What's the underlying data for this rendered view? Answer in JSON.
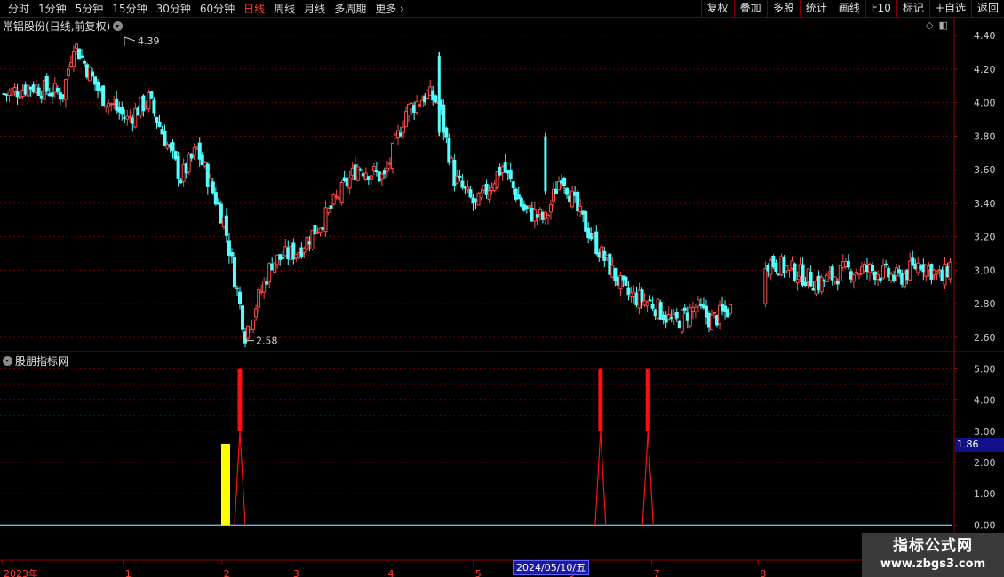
{
  "toolbar": {
    "periods": [
      "分时",
      "1分钟",
      "5分钟",
      "15分钟",
      "30分钟",
      "60分钟",
      "日线",
      "周线",
      "月线",
      "多周期",
      "更多"
    ],
    "active_period": "日线",
    "tools": [
      "复权",
      "叠加",
      "多股",
      "统计",
      "画线",
      "F10",
      "标记",
      "+自选",
      "返回"
    ]
  },
  "main_panel": {
    "title": "常铝股份(日线,前复权)"
  },
  "indicator_panel": {
    "title": "股朋指标网"
  },
  "price_axis": {
    "ticks": [
      "4.40",
      "4.20",
      "4.00",
      "3.80",
      "3.60",
      "3.40",
      "3.20",
      "3.00",
      "2.80",
      "2.60"
    ],
    "range": [
      2.52,
      4.48
    ]
  },
  "indicator_axis": {
    "ticks": [
      "5.00",
      "4.00",
      "3.00",
      "2.00",
      "1.00",
      "0.00"
    ],
    "range": [
      -1.1,
      5.5
    ],
    "current_value": "1.86"
  },
  "annotations": {
    "high": "4.39",
    "low": "2.58"
  },
  "time_axis": {
    "labels": [
      "2023年",
      "1",
      "2",
      "3",
      "4",
      "5",
      "6",
      "7",
      "8"
    ],
    "hover_date": "2024/05/10/五"
  },
  "colors": {
    "up": "#ff4a4a",
    "down": "#54ffff",
    "grid": "#6a0000",
    "signal_red": "#ff1010",
    "signal_yellow": "#ffff00",
    "zero_line": "#3ac8e8"
  },
  "chart_data": {
    "type": "candlestick",
    "segments": [
      {
        "n": 54,
        "start": 4.05,
        "points": [
          [
            10,
            4.1
          ],
          [
            22,
            4.05
          ],
          [
            26,
            4.36
          ],
          [
            36,
            4.05
          ],
          [
            46,
            3.9
          ],
          [
            54,
            4.02
          ]
        ]
      },
      {
        "n": 56,
        "start": 4.02,
        "points": [
          [
            12,
            3.55
          ],
          [
            18,
            3.72
          ],
          [
            28,
            3.3
          ],
          [
            36,
            2.62
          ],
          [
            46,
            3.05
          ],
          [
            56,
            3.12
          ]
        ]
      },
      {
        "n": 52,
        "start": 3.12,
        "points": [
          [
            10,
            3.32
          ],
          [
            22,
            3.62
          ],
          [
            32,
            3.55
          ],
          [
            40,
            3.95
          ],
          [
            48,
            4.05
          ],
          [
            52,
            4.0
          ]
        ]
      },
      {
        "n": 52,
        "start": 4.0,
        "points": [
          [
            6,
            3.55
          ],
          [
            14,
            3.38
          ],
          [
            24,
            3.62
          ],
          [
            32,
            3.36
          ],
          [
            40,
            3.3
          ],
          [
            46,
            3.58
          ],
          [
            52,
            3.35
          ]
        ]
      },
      {
        "n": 58,
        "start": 3.35,
        "points": [
          [
            8,
            3.12
          ],
          [
            18,
            2.86
          ],
          [
            28,
            2.8
          ],
          [
            36,
            2.68
          ],
          [
            44,
            2.78
          ],
          [
            50,
            2.7
          ],
          [
            58,
            2.78
          ]
        ]
      },
      {
        "n": 70,
        "start": 3.06,
        "points": [
          [
            10,
            3.0
          ],
          [
            20,
            2.92
          ],
          [
            30,
            3.0
          ],
          [
            40,
            3.0
          ],
          [
            50,
            2.95
          ],
          [
            58,
            3.05
          ],
          [
            66,
            2.95
          ],
          [
            70,
            3.06
          ]
        ]
      }
    ],
    "gap_after_segment": 4,
    "gap_size": 12,
    "signals": [
      {
        "x_frac": 0.25,
        "kind": "red_spike",
        "value": 5
      },
      {
        "x_frac": 0.63,
        "kind": "red_spike",
        "value": 5
      },
      {
        "x_frac": 0.68,
        "kind": "red_spike",
        "value": 5
      }
    ],
    "yellow_bar": {
      "x_frac": 0.235,
      "value": 2.6
    },
    "time_label_fracs": [
      0,
      0.128,
      0.232,
      0.305,
      0.405,
      0.497,
      0.595,
      0.685,
      0.797
    ]
  }
}
